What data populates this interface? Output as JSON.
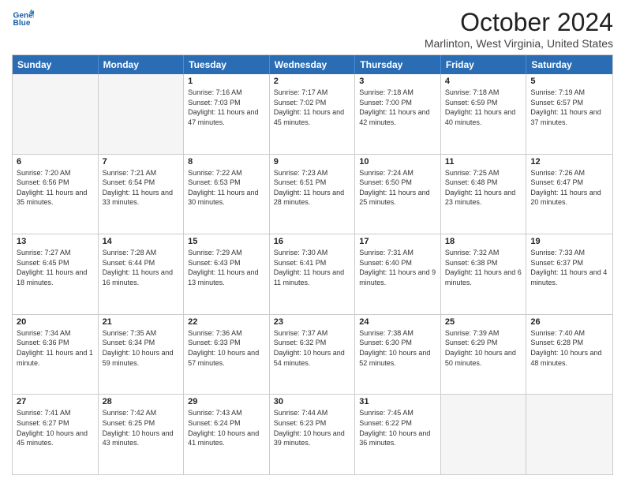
{
  "header": {
    "logo_line1": "General",
    "logo_line2": "Blue",
    "month_title": "October 2024",
    "location": "Marlinton, West Virginia, United States"
  },
  "days_of_week": [
    "Sunday",
    "Monday",
    "Tuesday",
    "Wednesday",
    "Thursday",
    "Friday",
    "Saturday"
  ],
  "weeks": [
    [
      {
        "day": "",
        "info": ""
      },
      {
        "day": "",
        "info": ""
      },
      {
        "day": "1",
        "info": "Sunrise: 7:16 AM\nSunset: 7:03 PM\nDaylight: 11 hours and 47 minutes."
      },
      {
        "day": "2",
        "info": "Sunrise: 7:17 AM\nSunset: 7:02 PM\nDaylight: 11 hours and 45 minutes."
      },
      {
        "day": "3",
        "info": "Sunrise: 7:18 AM\nSunset: 7:00 PM\nDaylight: 11 hours and 42 minutes."
      },
      {
        "day": "4",
        "info": "Sunrise: 7:18 AM\nSunset: 6:59 PM\nDaylight: 11 hours and 40 minutes."
      },
      {
        "day": "5",
        "info": "Sunrise: 7:19 AM\nSunset: 6:57 PM\nDaylight: 11 hours and 37 minutes."
      }
    ],
    [
      {
        "day": "6",
        "info": "Sunrise: 7:20 AM\nSunset: 6:56 PM\nDaylight: 11 hours and 35 minutes."
      },
      {
        "day": "7",
        "info": "Sunrise: 7:21 AM\nSunset: 6:54 PM\nDaylight: 11 hours and 33 minutes."
      },
      {
        "day": "8",
        "info": "Sunrise: 7:22 AM\nSunset: 6:53 PM\nDaylight: 11 hours and 30 minutes."
      },
      {
        "day": "9",
        "info": "Sunrise: 7:23 AM\nSunset: 6:51 PM\nDaylight: 11 hours and 28 minutes."
      },
      {
        "day": "10",
        "info": "Sunrise: 7:24 AM\nSunset: 6:50 PM\nDaylight: 11 hours and 25 minutes."
      },
      {
        "day": "11",
        "info": "Sunrise: 7:25 AM\nSunset: 6:48 PM\nDaylight: 11 hours and 23 minutes."
      },
      {
        "day": "12",
        "info": "Sunrise: 7:26 AM\nSunset: 6:47 PM\nDaylight: 11 hours and 20 minutes."
      }
    ],
    [
      {
        "day": "13",
        "info": "Sunrise: 7:27 AM\nSunset: 6:45 PM\nDaylight: 11 hours and 18 minutes."
      },
      {
        "day": "14",
        "info": "Sunrise: 7:28 AM\nSunset: 6:44 PM\nDaylight: 11 hours and 16 minutes."
      },
      {
        "day": "15",
        "info": "Sunrise: 7:29 AM\nSunset: 6:43 PM\nDaylight: 11 hours and 13 minutes."
      },
      {
        "day": "16",
        "info": "Sunrise: 7:30 AM\nSunset: 6:41 PM\nDaylight: 11 hours and 11 minutes."
      },
      {
        "day": "17",
        "info": "Sunrise: 7:31 AM\nSunset: 6:40 PM\nDaylight: 11 hours and 9 minutes."
      },
      {
        "day": "18",
        "info": "Sunrise: 7:32 AM\nSunset: 6:38 PM\nDaylight: 11 hours and 6 minutes."
      },
      {
        "day": "19",
        "info": "Sunrise: 7:33 AM\nSunset: 6:37 PM\nDaylight: 11 hours and 4 minutes."
      }
    ],
    [
      {
        "day": "20",
        "info": "Sunrise: 7:34 AM\nSunset: 6:36 PM\nDaylight: 11 hours and 1 minute."
      },
      {
        "day": "21",
        "info": "Sunrise: 7:35 AM\nSunset: 6:34 PM\nDaylight: 10 hours and 59 minutes."
      },
      {
        "day": "22",
        "info": "Sunrise: 7:36 AM\nSunset: 6:33 PM\nDaylight: 10 hours and 57 minutes."
      },
      {
        "day": "23",
        "info": "Sunrise: 7:37 AM\nSunset: 6:32 PM\nDaylight: 10 hours and 54 minutes."
      },
      {
        "day": "24",
        "info": "Sunrise: 7:38 AM\nSunset: 6:30 PM\nDaylight: 10 hours and 52 minutes."
      },
      {
        "day": "25",
        "info": "Sunrise: 7:39 AM\nSunset: 6:29 PM\nDaylight: 10 hours and 50 minutes."
      },
      {
        "day": "26",
        "info": "Sunrise: 7:40 AM\nSunset: 6:28 PM\nDaylight: 10 hours and 48 minutes."
      }
    ],
    [
      {
        "day": "27",
        "info": "Sunrise: 7:41 AM\nSunset: 6:27 PM\nDaylight: 10 hours and 45 minutes."
      },
      {
        "day": "28",
        "info": "Sunrise: 7:42 AM\nSunset: 6:25 PM\nDaylight: 10 hours and 43 minutes."
      },
      {
        "day": "29",
        "info": "Sunrise: 7:43 AM\nSunset: 6:24 PM\nDaylight: 10 hours and 41 minutes."
      },
      {
        "day": "30",
        "info": "Sunrise: 7:44 AM\nSunset: 6:23 PM\nDaylight: 10 hours and 39 minutes."
      },
      {
        "day": "31",
        "info": "Sunrise: 7:45 AM\nSunset: 6:22 PM\nDaylight: 10 hours and 36 minutes."
      },
      {
        "day": "",
        "info": ""
      },
      {
        "day": "",
        "info": ""
      }
    ]
  ]
}
